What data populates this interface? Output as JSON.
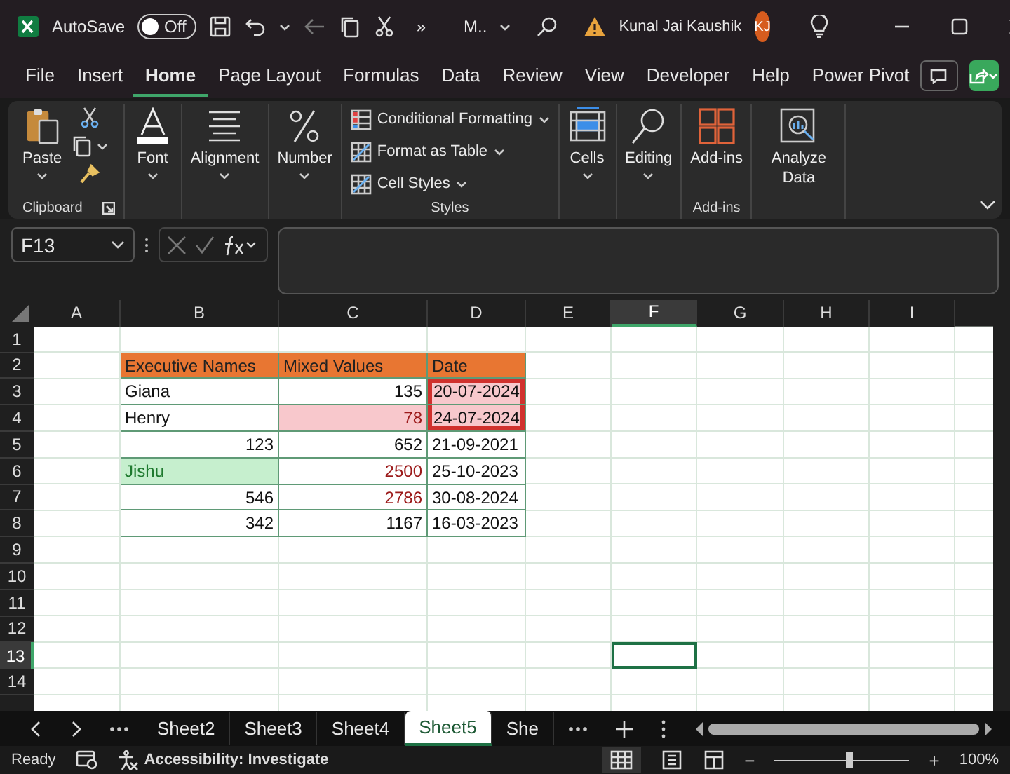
{
  "title_bar": {
    "autosave_label": "AutoSave",
    "autosave": {
      "on": false,
      "label": "Off"
    },
    "more": "»",
    "file_name": "M..",
    "user_name": "Kunal Jai Kaushik",
    "avatar": "KJ"
  },
  "menu_tabs": [
    {
      "label": "File",
      "selected": false
    },
    {
      "label": "Insert",
      "selected": false
    },
    {
      "label": "Home",
      "selected": true
    },
    {
      "label": "Page Layout",
      "selected": false
    },
    {
      "label": "Formulas",
      "selected": false
    },
    {
      "label": "Data",
      "selected": false
    },
    {
      "label": "Review",
      "selected": false
    },
    {
      "label": "View",
      "selected": false
    },
    {
      "label": "Developer",
      "selected": false
    },
    {
      "label": "Help",
      "selected": false
    },
    {
      "label": "Power Pivot",
      "selected": false
    }
  ],
  "ribbon": {
    "groups": [
      {
        "kind": "clipboard",
        "label": "Clipboard",
        "buttons": [
          {
            "label": "Paste"
          }
        ]
      },
      {
        "kind": "large",
        "buttons": [
          {
            "label": "Font"
          }
        ]
      },
      {
        "kind": "large",
        "buttons": [
          {
            "label": "Alignment"
          }
        ]
      },
      {
        "kind": "large",
        "buttons": [
          {
            "label": "Number"
          }
        ]
      },
      {
        "kind": "list",
        "label": "Styles",
        "buttons": [
          {
            "label": "Conditional Formatting"
          },
          {
            "label": "Format as Table"
          },
          {
            "label": "Cell Styles"
          }
        ]
      },
      {
        "kind": "large",
        "buttons": [
          {
            "label": "Cells"
          }
        ]
      },
      {
        "kind": "large",
        "buttons": [
          {
            "label": "Editing"
          }
        ]
      },
      {
        "kind": "large",
        "label": "Add-ins",
        "buttons": [
          {
            "label": "Add-ins"
          }
        ]
      },
      {
        "kind": "large",
        "buttons": [
          {
            "label": "Analyze Data"
          }
        ]
      }
    ]
  },
  "formula_bar": {
    "name_box": "F13"
  },
  "sheet": {
    "columns": [
      {
        "label": "A",
        "selected": false
      },
      {
        "label": "B",
        "selected": false
      },
      {
        "label": "C",
        "selected": false
      },
      {
        "label": "D",
        "selected": false
      },
      {
        "label": "E",
        "selected": false
      },
      {
        "label": "F",
        "selected": true
      },
      {
        "label": "G",
        "selected": false
      },
      {
        "label": "H",
        "selected": false
      },
      {
        "label": "I",
        "selected": false
      }
    ],
    "rows": [
      {
        "label": "1",
        "selected": false,
        "cells": {}
      },
      {
        "label": "2",
        "selected": false,
        "cells": {
          "B": {
            "text": "Executive Names",
            "kind": "header"
          },
          "C": {
            "text": "Mixed Values",
            "kind": "header"
          },
          "D": {
            "text": "Date",
            "kind": "header"
          }
        }
      },
      {
        "label": "3",
        "selected": false,
        "cells": {
          "B": {
            "text": "Giana",
            "kind": "text"
          },
          "C": {
            "text": "135",
            "kind": "number"
          },
          "D": {
            "text": "20-07-2024",
            "kind": "pink-fill",
            "outlined": true
          }
        }
      },
      {
        "label": "4",
        "selected": false,
        "cells": {
          "B": {
            "text": "Henry",
            "kind": "text"
          },
          "C": {
            "text": "78",
            "kind": "red-fill-number"
          },
          "D": {
            "text": "24-07-2024",
            "kind": "pink-fill",
            "outlined": true
          }
        }
      },
      {
        "label": "5",
        "selected": false,
        "cells": {
          "B": {
            "text": "123",
            "kind": "number"
          },
          "C": {
            "text": "652",
            "kind": "number"
          },
          "D": {
            "text": "21-09-2021",
            "kind": "text"
          }
        }
      },
      {
        "label": "6",
        "selected": false,
        "cells": {
          "B": {
            "text": "Jishu",
            "kind": "green-fill"
          },
          "C": {
            "text": "2500",
            "kind": "red-number"
          },
          "D": {
            "text": "25-10-2023",
            "kind": "text"
          }
        }
      },
      {
        "label": "7",
        "selected": false,
        "cells": {
          "B": {
            "text": "546",
            "kind": "number"
          },
          "C": {
            "text": "2786",
            "kind": "red-number"
          },
          "D": {
            "text": "30-08-2024",
            "kind": "text"
          }
        }
      },
      {
        "label": "8",
        "selected": false,
        "cells": {
          "B": {
            "text": "342",
            "kind": "number"
          },
          "C": {
            "text": "1167",
            "kind": "number"
          },
          "D": {
            "text": "16-03-2023",
            "kind": "text"
          }
        }
      },
      {
        "label": "9",
        "selected": false,
        "cells": {}
      },
      {
        "label": "10",
        "selected": false,
        "cells": {}
      },
      {
        "label": "11",
        "selected": false,
        "cells": {}
      },
      {
        "label": "12",
        "selected": false,
        "cells": {}
      },
      {
        "label": "13",
        "selected": true,
        "cells": {
          "F": {
            "selected": true
          }
        }
      },
      {
        "label": "14",
        "selected": false,
        "cells": {}
      }
    ]
  },
  "sheet_tabs": [
    {
      "label": "Sheet2",
      "selected": false
    },
    {
      "label": "Sheet3",
      "selected": false
    },
    {
      "label": "Sheet4",
      "selected": false
    },
    {
      "label": "Sheet5",
      "selected": true
    },
    {
      "label": "She",
      "selected": false
    }
  ],
  "status_bar": {
    "status": "Ready",
    "accessibility": "Accessibility: Investigate",
    "zoom_out": "−",
    "zoom_slider": {
      "level": 0.55
    },
    "zoom_in": "+",
    "zoom": "100%"
  }
}
